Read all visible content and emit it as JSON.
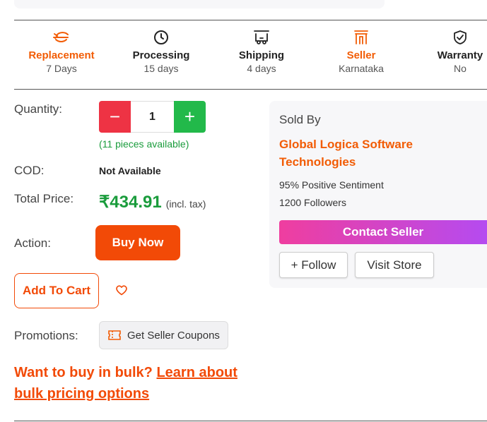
{
  "features": [
    {
      "title": "Replacement",
      "sub": "7 Days",
      "icon": "replacement-icon"
    },
    {
      "title": "Processing",
      "sub": "15 days",
      "icon": "clock-icon"
    },
    {
      "title": "Shipping",
      "sub": "4 days",
      "icon": "truck-icon"
    },
    {
      "title": "Seller",
      "sub": "Karnataka",
      "icon": "store-icon"
    },
    {
      "title": "Warranty",
      "sub": "No",
      "icon": "shield-check-icon"
    }
  ],
  "quantity": {
    "label": "Quantity:",
    "minus": "−",
    "value": "1",
    "plus": "+",
    "available": "(11 pieces available)"
  },
  "cod": {
    "label": "COD:",
    "value": "Not Available"
  },
  "price": {
    "label": "Total Price:",
    "amount": "₹434.91",
    "tax_note": "(incl. tax)"
  },
  "action": {
    "label": "Action:",
    "buy_now": "Buy Now"
  },
  "add_to_cart": "Add To Cart",
  "promotions": {
    "label": "Promotions:",
    "coupon_button": "Get Seller Coupons"
  },
  "bulk": {
    "prefix": "Want to buy in bulk? ",
    "link": "Learn about bulk pricing options"
  },
  "seller": {
    "sold_by": "Sold By",
    "name": "Global Logica Software Technologies",
    "sentiment": "95% Positive Sentiment",
    "followers": "1200 Followers",
    "contact": "Contact Seller",
    "follow": "+ Follow",
    "visit_store": "Visit Store"
  },
  "colors": {
    "accent": "#f24a07",
    "green": "#1a9c3c",
    "minus_red": "#ee3344",
    "plus_green": "#22b94a",
    "gradient_start": "#ef3e9f",
    "gradient_end": "#b54bf0"
  }
}
